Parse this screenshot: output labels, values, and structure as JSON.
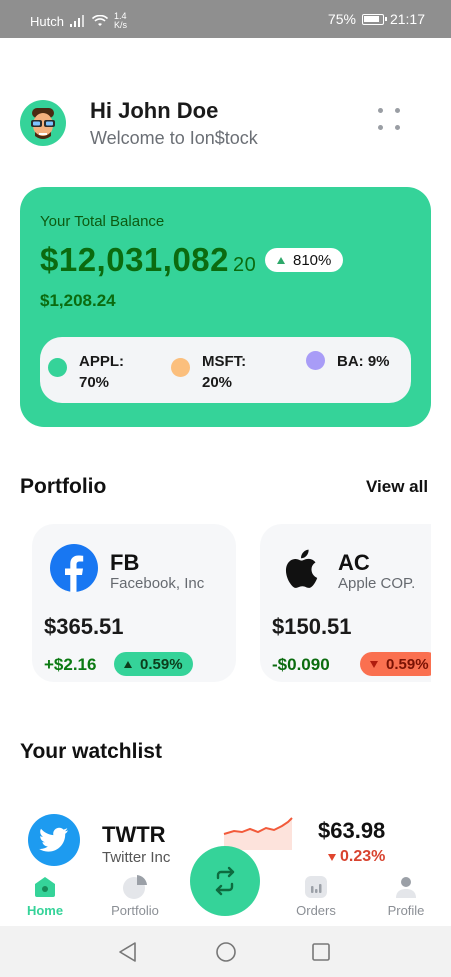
{
  "status_bar": {
    "carrier": "Hutch",
    "speed_value": "1.4",
    "speed_unit": "K/s",
    "battery": "75%",
    "time": "21:17",
    "icons": [
      "signal-icon",
      "wifi-icon",
      "battery-icon"
    ]
  },
  "header": {
    "greeting": "Hi John Doe",
    "welcome": "Welcome to Ion$tock",
    "avatar_icon": "avatar-emoji",
    "menu_icon": "more-dots-icon"
  },
  "balance": {
    "label": "Your Total Balance",
    "amount": "$12,031,082",
    "cents": "20",
    "change": "810%",
    "sub_amount": "$1,208.24",
    "card_color": "#35d399",
    "allocation": [
      {
        "name": "APPL:",
        "value": "70%",
        "color": "#35d399"
      },
      {
        "name": "MSFT:",
        "value": "20%",
        "color": "#fbbf7d"
      },
      {
        "name": "BA:",
        "value": "9%",
        "color": "#a89cf7"
      }
    ]
  },
  "portfolio": {
    "title": "Portfolio",
    "view_all": "View all",
    "cards": [
      {
        "ticker": "FB",
        "company": "Facebook, Inc",
        "price": "$365.51",
        "change": "+$2.16",
        "percent": "0.59%",
        "direction": "up",
        "icon": "facebook-icon"
      },
      {
        "ticker": "AC",
        "company": "Apple COP.",
        "price": "$150.51",
        "change": "-$0.090",
        "percent": "0.59%",
        "direction": "down",
        "icon": "apple-icon"
      }
    ]
  },
  "watchlist": {
    "title": "Your watchlist",
    "items": [
      {
        "ticker": "TWTR",
        "company": "Twitter Inc",
        "price": "$63.98",
        "percent": "0.23%",
        "direction": "down",
        "icon": "twitter-icon"
      }
    ]
  },
  "bottom_nav": {
    "items": [
      {
        "label": "Home",
        "icon": "home-icon",
        "active": true
      },
      {
        "label": "Portfolio",
        "icon": "pie-chart-icon",
        "active": false
      },
      {
        "label": "Orders",
        "icon": "orders-icon",
        "active": false
      },
      {
        "label": "Profile",
        "icon": "profile-icon",
        "active": false
      }
    ],
    "fab_icon": "swap-icon"
  },
  "accent_color": "#35d399"
}
